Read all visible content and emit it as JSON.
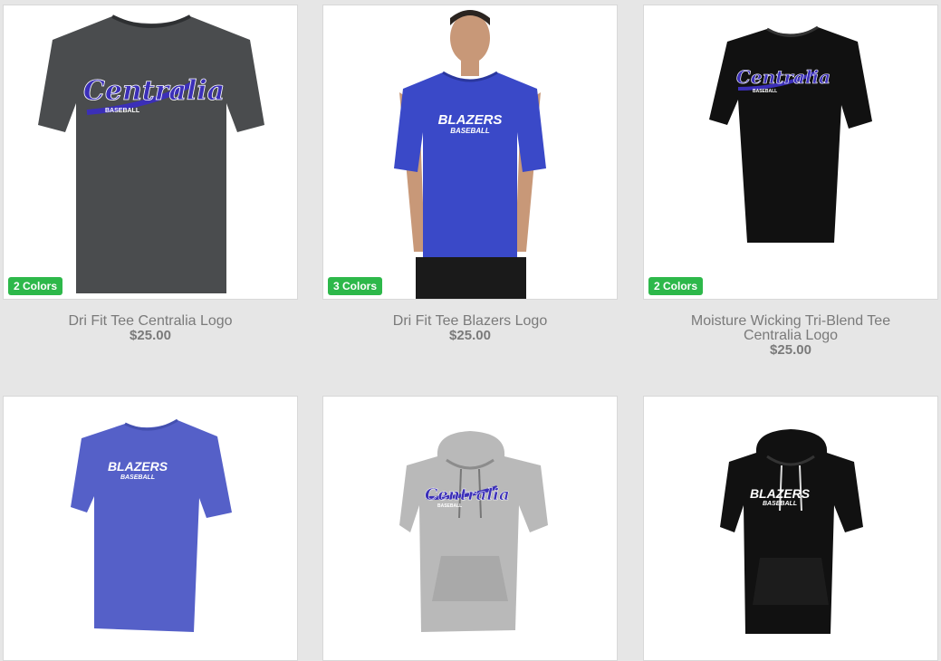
{
  "products": [
    {
      "name": "Dri Fit Tee Centralia Logo",
      "price": "$25.00",
      "badge": "2 Colors",
      "print": "Centralia",
      "sub": "BASEBALL",
      "color": "#4a4c4e"
    },
    {
      "name": "Dri Fit Tee Blazers Logo",
      "price": "$25.00",
      "badge": "3 Colors",
      "print": "BLAZERS",
      "sub": "BASEBALL",
      "color": "#3a49c8"
    },
    {
      "name_line1": "Moisture Wicking Tri-Blend Tee",
      "name_line2": "Centralia Logo",
      "price": "$25.00",
      "badge": "2 Colors",
      "print": "Centralia",
      "sub": "BASEBALL",
      "color": "#111111"
    },
    {
      "print": "BLAZERS",
      "sub": "BASEBALL",
      "color": "#5560c8"
    },
    {
      "print": "Centralia",
      "sub": "BASEBALL",
      "color": "#b9b9b9"
    },
    {
      "print": "BLAZERS",
      "sub": "BASEBALL",
      "color": "#111111"
    }
  ],
  "colors": {
    "badge": "#2db84a",
    "background": "#e6e6e6",
    "logo_purple": "#3b2fb8"
  }
}
